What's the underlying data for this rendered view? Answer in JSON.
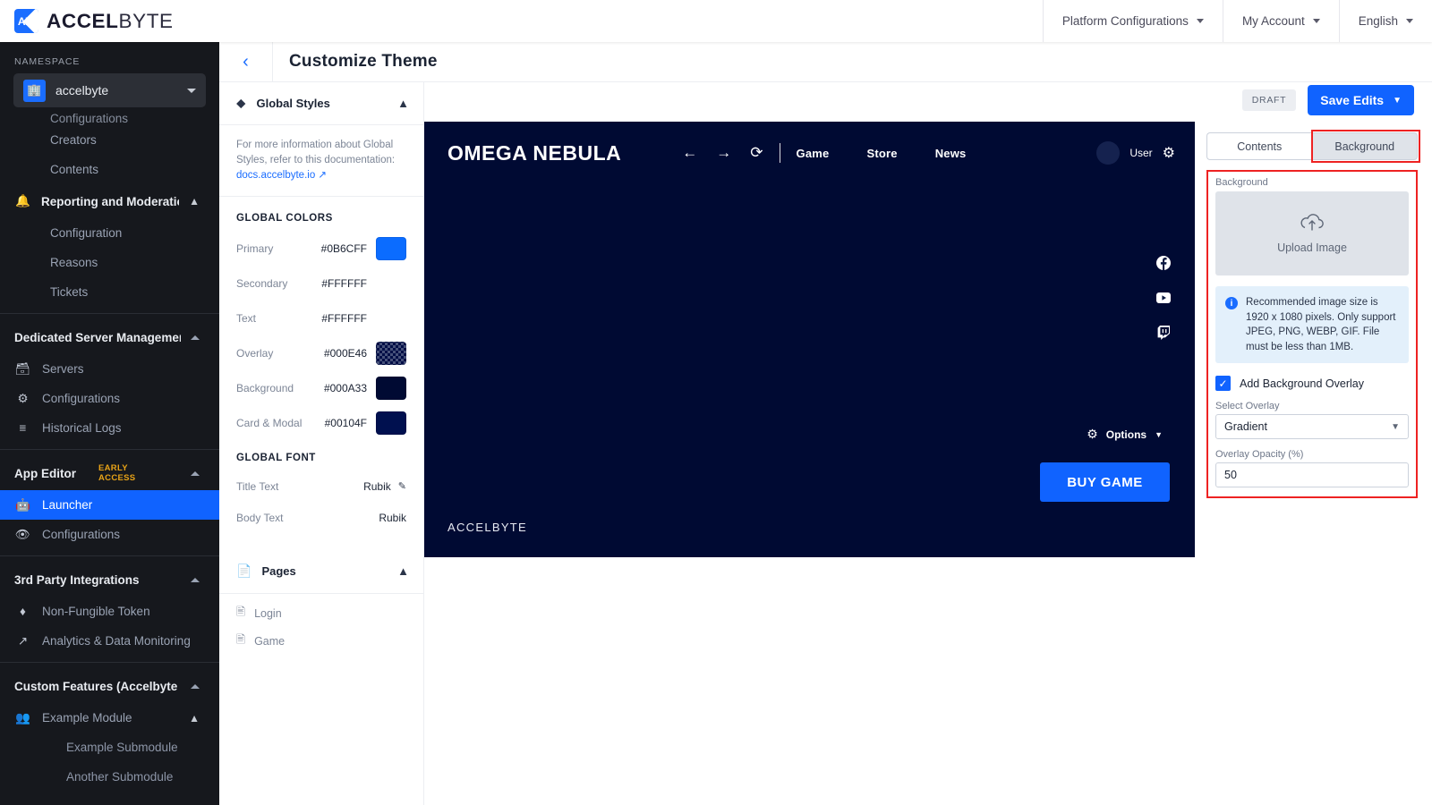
{
  "topbar": {
    "brand_short": "AB",
    "brand_name_1": "ACCEL",
    "brand_name_2": "BYTE",
    "nav": [
      {
        "label": "Platform Configurations"
      },
      {
        "label": "My Account"
      },
      {
        "label": "English"
      }
    ]
  },
  "sidebar": {
    "namespace_label": "NAMESPACE",
    "namespace_value": "accelbyte",
    "items": [
      {
        "label": "Configurations",
        "type": "sub",
        "clipped": true
      },
      {
        "label": "Creators",
        "type": "sub"
      },
      {
        "label": "Contents",
        "type": "sub"
      },
      {
        "label": "Reporting and Moderation",
        "type": "group",
        "icon": "bell-icon"
      },
      {
        "label": "Configuration",
        "type": "sub"
      },
      {
        "label": "Reasons",
        "type": "sub"
      },
      {
        "label": "Tickets",
        "type": "sub"
      },
      {
        "label": "Dedicated Server Management",
        "type": "group"
      },
      {
        "label": "Servers",
        "type": "item",
        "icon": "server-icon"
      },
      {
        "label": "Configurations",
        "type": "item",
        "icon": "gear-icon"
      },
      {
        "label": "Historical Logs",
        "type": "item",
        "icon": "list-icon"
      },
      {
        "label": "App Editor",
        "type": "group",
        "badge": "EARLY ACCESS"
      },
      {
        "label": "Launcher",
        "type": "item",
        "icon": "robot-icon",
        "active": true
      },
      {
        "label": "Configurations",
        "type": "item",
        "icon": "eye-icon"
      },
      {
        "label": "3rd Party Integrations",
        "type": "group"
      },
      {
        "label": "Non-Fungible Token",
        "type": "item",
        "icon": "nft-icon"
      },
      {
        "label": "Analytics & Data Monitoring",
        "type": "item",
        "icon": "trend-icon"
      },
      {
        "label": "Custom Features (Accelbyte In...",
        "type": "group"
      },
      {
        "label": "Example Module",
        "type": "item",
        "icon": "people-icon",
        "expandable": true
      },
      {
        "label": "Example Submodule",
        "type": "sub2"
      },
      {
        "label": "Another Submodule",
        "type": "sub2"
      }
    ]
  },
  "page": {
    "title": "Customize Theme",
    "back_icon": "chevron-left-icon",
    "draft_badge": "DRAFT",
    "save_label": "Save Edits"
  },
  "styles_panel": {
    "section_title": "Global Styles",
    "helper_text": "For more information about Global Styles, refer to this documentation:",
    "helper_link": "docs.accelbyte.io",
    "colors_title": "GLOBAL COLORS",
    "colors": [
      {
        "label": "Primary",
        "hex": "#0B6CFF",
        "swatch": true,
        "checker": false
      },
      {
        "label": "Secondary",
        "hex": "#FFFFFF",
        "swatch": false,
        "checker": false
      },
      {
        "label": "Text",
        "hex": "#FFFFFF",
        "swatch": false,
        "checker": false
      },
      {
        "label": "Overlay",
        "hex": "#000E46",
        "swatch": true,
        "checker": true
      },
      {
        "label": "Background",
        "hex": "#000A33",
        "swatch": true,
        "checker": false
      },
      {
        "label": "Card & Modal",
        "hex": "#00104F",
        "swatch": true,
        "checker": false
      }
    ],
    "font_title": "GLOBAL FONT",
    "fonts": [
      {
        "label": "Title Text",
        "value": "Rubik",
        "editable": true
      },
      {
        "label": "Body Text",
        "value": "Rubik",
        "editable": false
      }
    ],
    "pages_title": "Pages",
    "pages": [
      {
        "label": "Login"
      },
      {
        "label": "Game"
      }
    ]
  },
  "preview": {
    "logo": "OMEGA NEBULA",
    "nav_links": [
      "Game",
      "Store",
      "News"
    ],
    "user_label": "User",
    "social": [
      "facebook-icon",
      "youtube-icon",
      "twitch-icon"
    ],
    "options_label": "Options",
    "buy_label": "BUY GAME",
    "footer_brand": "ACCELBYTE",
    "background_color": "#000A33"
  },
  "right_panel": {
    "tabs": [
      {
        "label": "Contents",
        "active": false
      },
      {
        "label": "Background",
        "active": true
      }
    ],
    "background_label": "Background",
    "upload_label": "Upload Image",
    "info_text": "Recommended image size is 1920 x 1080 pixels. Only support JPEG, PNG, WEBP, GIF. File must be less than 1MB.",
    "overlay_checkbox_label": "Add Background Overlay",
    "overlay_checked": true,
    "select_overlay_label": "Select Overlay",
    "select_overlay_value": "Gradient",
    "opacity_label": "Overlay Opacity (%)",
    "opacity_value": "50",
    "highlight_color": "#EE2222"
  }
}
